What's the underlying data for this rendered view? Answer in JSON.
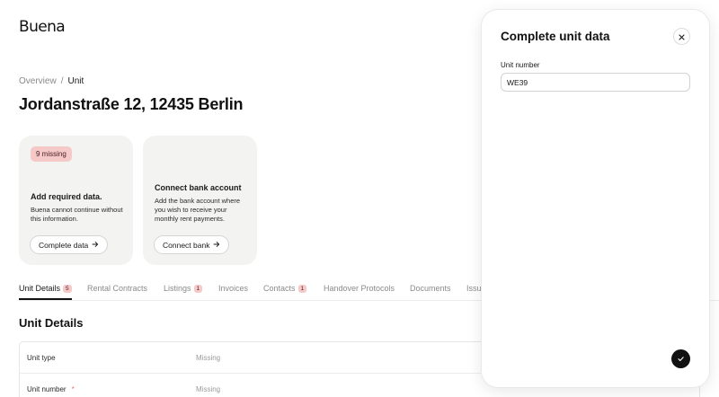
{
  "app": {
    "logo": "Buena"
  },
  "breadcrumb": {
    "items": [
      "Overview",
      "Unit"
    ],
    "separator": "/"
  },
  "page": {
    "title": "Jordanstraße 12, 12435 Berlin"
  },
  "cards": [
    {
      "badge": "9 missing",
      "heading": "Add required data.",
      "text": "Buena cannot continue without this information.",
      "button": "Complete data",
      "button_icon": "arrow-right-icon"
    },
    {
      "heading": "Connect bank account",
      "text": "Add the bank account where you wish to receive your monthly rent payments.",
      "button": "Connect bank",
      "button_icon": "arrow-right-icon"
    }
  ],
  "tabs": [
    {
      "label": "Unit Details",
      "count": "5",
      "active": true
    },
    {
      "label": "Rental Contracts"
    },
    {
      "label": "Listings",
      "count": "1"
    },
    {
      "label": "Invoices"
    },
    {
      "label": "Contacts",
      "count": "1"
    },
    {
      "label": "Handover Protocols"
    },
    {
      "label": "Documents"
    },
    {
      "label": "Issu"
    }
  ],
  "section": {
    "title": "Unit Details"
  },
  "table": {
    "rows": [
      {
        "label": "Unit type",
        "value": "Missing",
        "required": false
      },
      {
        "label": "Unit number",
        "value": "Missing",
        "required": true,
        "required_mark": "*"
      }
    ]
  },
  "drawer": {
    "title": "Complete unit data",
    "close_icon": "close-icon",
    "field_label": "Unit number",
    "field_value": "WE39",
    "confirm_icon": "checkmark-icon"
  },
  "colors": {
    "badge_bg": "#f6c9c9",
    "card_bg": "#f3f3f1",
    "confirm_bg": "#111111",
    "required": "#e07a7a"
  }
}
